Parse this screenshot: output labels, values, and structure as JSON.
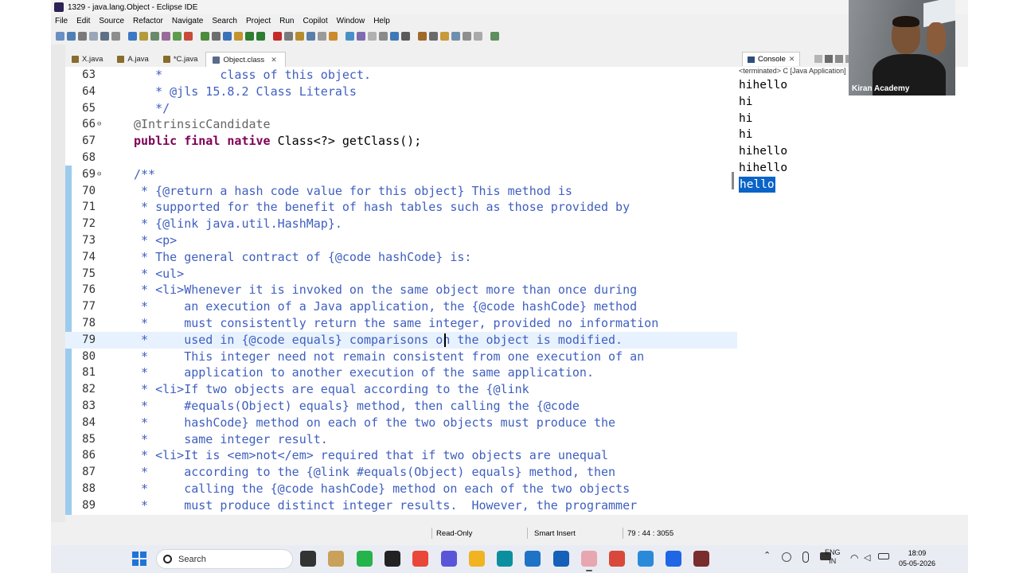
{
  "window": {
    "title": "1329 - java.lang.Object - Eclipse IDE"
  },
  "menu": [
    "File",
    "Edit",
    "Source",
    "Refactor",
    "Navigate",
    "Search",
    "Project",
    "Run",
    "Copilot",
    "Window",
    "Help"
  ],
  "editor_tabs": [
    {
      "label": "X.java",
      "active": false
    },
    {
      "label": "A.java",
      "active": false
    },
    {
      "label": "*C.java",
      "active": false
    },
    {
      "label": "Object.class",
      "active": true
    }
  ],
  "editor": {
    "current_line": 79,
    "lines": [
      {
        "num": "63",
        "text": "   *        class of this object.",
        "style": "comment"
      },
      {
        "num": "64",
        "text": "   * @jls 15.8.2 Class Literals",
        "style": "comment"
      },
      {
        "num": "65",
        "text": "   */",
        "style": "comment"
      },
      {
        "num": "66",
        "text": "@IntrinsicCandidate",
        "style": "annotation",
        "fold": "⊖"
      },
      {
        "num": "67",
        "text": "public final native Class<?> getClass();",
        "style": "code"
      },
      {
        "num": "68",
        "text": "",
        "style": "code"
      },
      {
        "num": "69",
        "text": "/**",
        "style": "comment",
        "fold": "⊖"
      },
      {
        "num": "70",
        "text": " * {@return a hash code value for this object} This method is",
        "style": "comment"
      },
      {
        "num": "71",
        "text": " * supported for the benefit of hash tables such as those provided by",
        "style": "comment"
      },
      {
        "num": "72",
        "text": " * {@link java.util.HashMap}.",
        "style": "comment"
      },
      {
        "num": "73",
        "text": " * <p>",
        "style": "comment"
      },
      {
        "num": "74",
        "text": " * The general contract of {@code hashCode} is:",
        "style": "comment"
      },
      {
        "num": "75",
        "text": " * <ul>",
        "style": "comment"
      },
      {
        "num": "76",
        "text": " * <li>Whenever it is invoked on the same object more than once during",
        "style": "comment"
      },
      {
        "num": "77",
        "text": " *     an execution of a Java application, the {@code hashCode} method",
        "style": "comment"
      },
      {
        "num": "78",
        "text": " *     must consistently return the same integer, provided no information",
        "style": "comment"
      },
      {
        "num": "79",
        "text": " *     used in {@code equals} comparisons on the object is modified.",
        "style": "comment"
      },
      {
        "num": "80",
        "text": " *     This integer need not remain consistent from one execution of an",
        "style": "comment"
      },
      {
        "num": "81",
        "text": " *     application to another execution of the same application.",
        "style": "comment"
      },
      {
        "num": "82",
        "text": " * <li>If two objects are equal according to the {@link",
        "style": "comment"
      },
      {
        "num": "83",
        "text": " *     #equals(Object) equals} method, then calling the {@code",
        "style": "comment"
      },
      {
        "num": "84",
        "text": " *     hashCode} method on each of the two objects must produce the",
        "style": "comment"
      },
      {
        "num": "85",
        "text": " *     same integer result.",
        "style": "comment"
      },
      {
        "num": "86",
        "text": " * <li>It is <em>not</em> required that if two objects are unequal",
        "style": "comment"
      },
      {
        "num": "87",
        "text": " *     according to the {@link #equals(Object) equals} method, then",
        "style": "comment"
      },
      {
        "num": "88",
        "text": " *     calling the {@code hashCode} method on each of the two objects",
        "style": "comment"
      },
      {
        "num": "89",
        "text": " *     must produce distinct integer results.  However, the programmer",
        "style": "comment"
      }
    ]
  },
  "console": {
    "tab_label": "Console",
    "status": "<terminated> C [Java Application]",
    "lines": [
      "hihello",
      "hi",
      "hi",
      "hi",
      "hihello",
      "hihello",
      "hello"
    ],
    "selected_index": 6
  },
  "statusbar": {
    "read_only": "Read-Only",
    "insert_mode": "Smart Insert",
    "position": "79 : 44 : 3055"
  },
  "webcam": {
    "label": "Kiran Academy"
  },
  "taskbar": {
    "search_placeholder": "Search",
    "lang": "ENG",
    "region": "IN",
    "time": "18:09",
    "date": "05-05-2026"
  },
  "colors": {
    "comment": "#3f5fbf",
    "keyword": "#7f0055",
    "annotation": "#646464",
    "current_line": "#e8f2fe",
    "selection": "#0a64c8"
  }
}
